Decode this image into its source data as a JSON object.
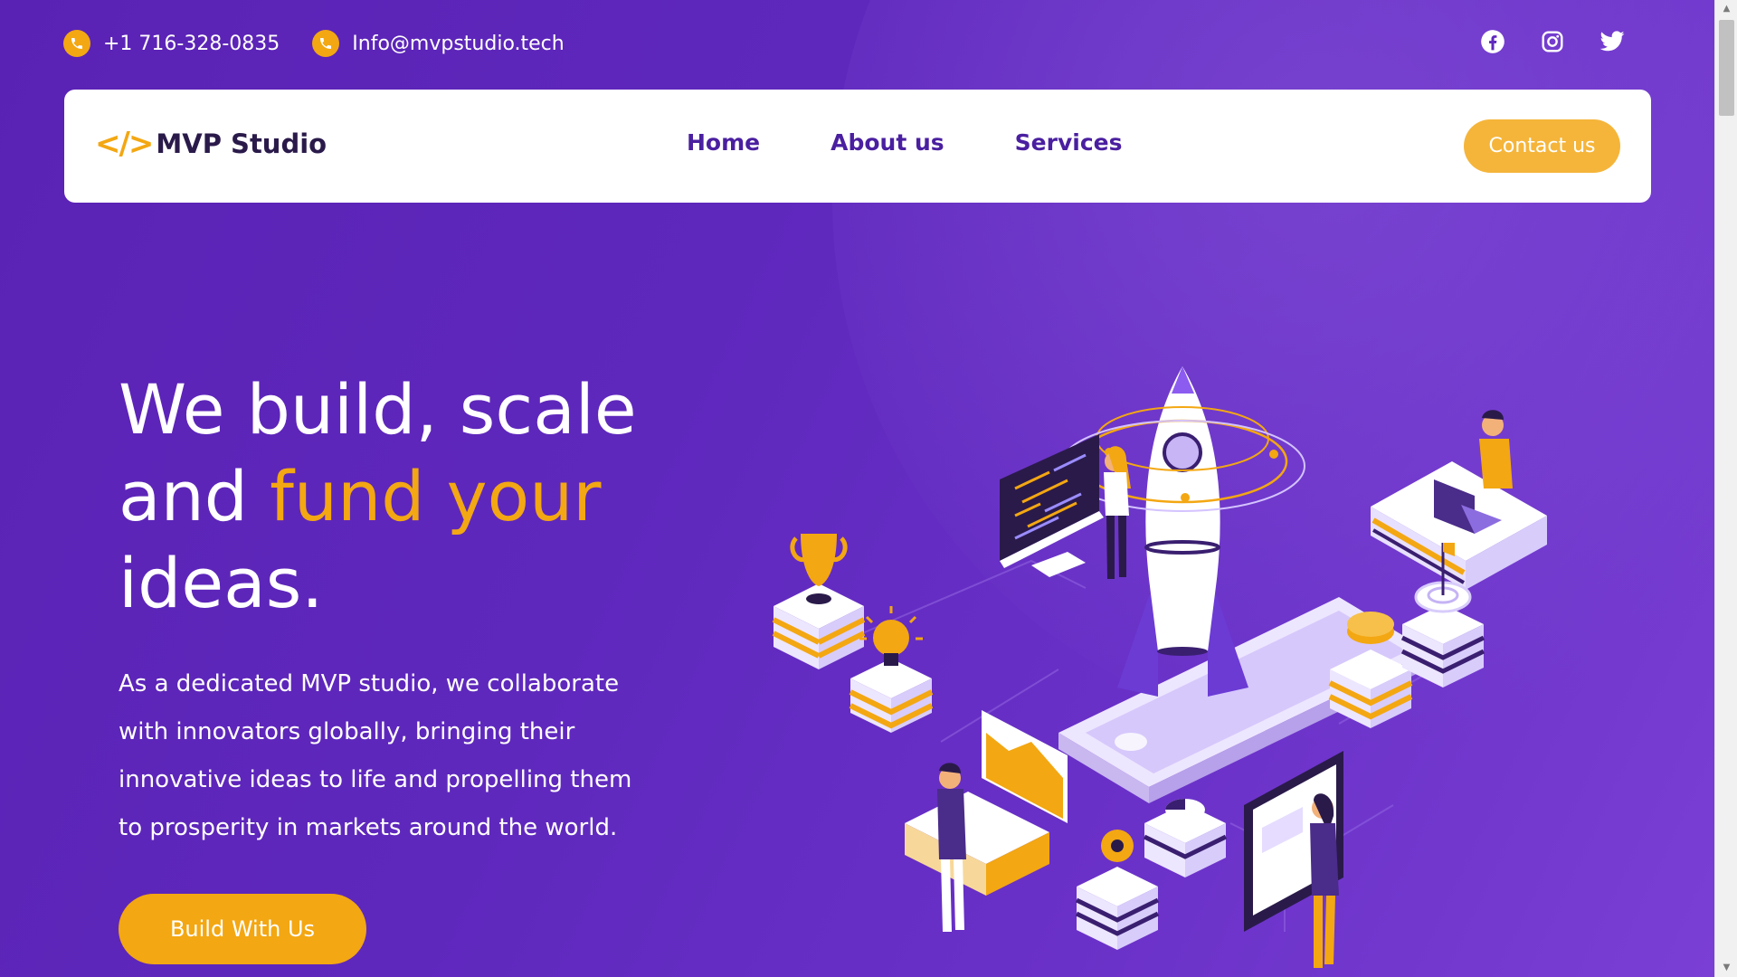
{
  "topbar": {
    "phone": "+1 716-328-0835",
    "email": "Info@mvpstudio.tech",
    "phone_icon": "phone-icon",
    "email_icon": "phone-icon"
  },
  "socials": [
    {
      "icon": "facebook-icon"
    },
    {
      "icon": "instagram-icon"
    },
    {
      "icon": "twitter-icon"
    }
  ],
  "navbar": {
    "logo_mark": "</>",
    "logo_text": "MVP Studio",
    "links": [
      "Home",
      "About us",
      "Services"
    ],
    "contact_label": "Contact us"
  },
  "hero": {
    "title_line1": "We build, scale",
    "title_line2_start": "and ",
    "title_line2_accent": "fund your",
    "title_line3": "ideas.",
    "description": "As a dedicated MVP studio, we collaborate with innovators globally, bringing their innovative ideas to life and propelling them to prosperity in markets around the world.",
    "cta_label": "Build With Us"
  },
  "colors": {
    "background": "#5f28bd",
    "accent": "#f3a712",
    "nav_text": "#4a1fa0",
    "contact_button": "#f5b53a"
  }
}
